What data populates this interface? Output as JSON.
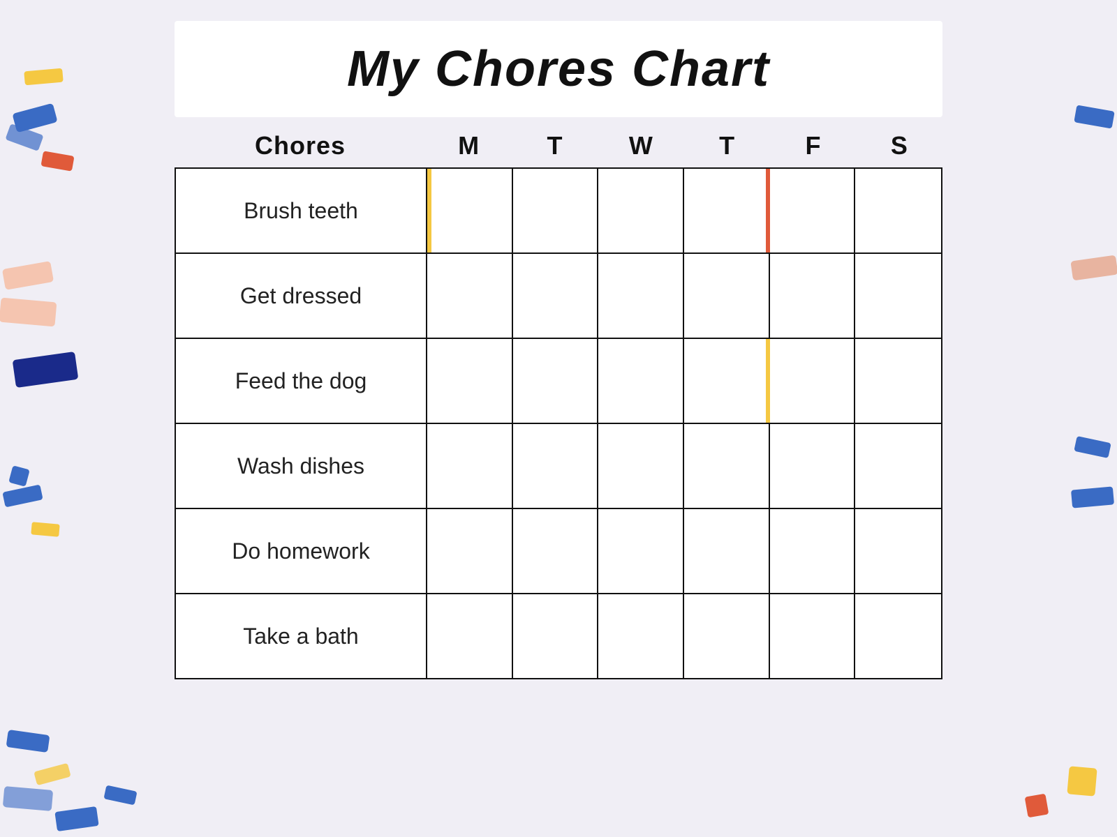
{
  "title": "My Chores Chart",
  "headers": {
    "chores": "Chores",
    "days": [
      "M",
      "T",
      "W",
      "T",
      "F",
      "S"
    ]
  },
  "rows": [
    {
      "chore": "Brush teeth"
    },
    {
      "chore": "Get dressed"
    },
    {
      "chore": "Feed the dog"
    },
    {
      "chore": "Wash dishes"
    },
    {
      "chore": "Do homework"
    },
    {
      "chore": "Take a bath"
    }
  ]
}
